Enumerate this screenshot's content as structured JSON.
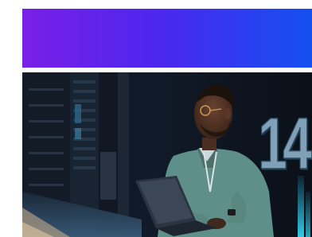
{
  "banner": {
    "color_start": "#7a1fe6",
    "color_end": "#1450f0"
  },
  "photo": {
    "badge_number": "14"
  }
}
